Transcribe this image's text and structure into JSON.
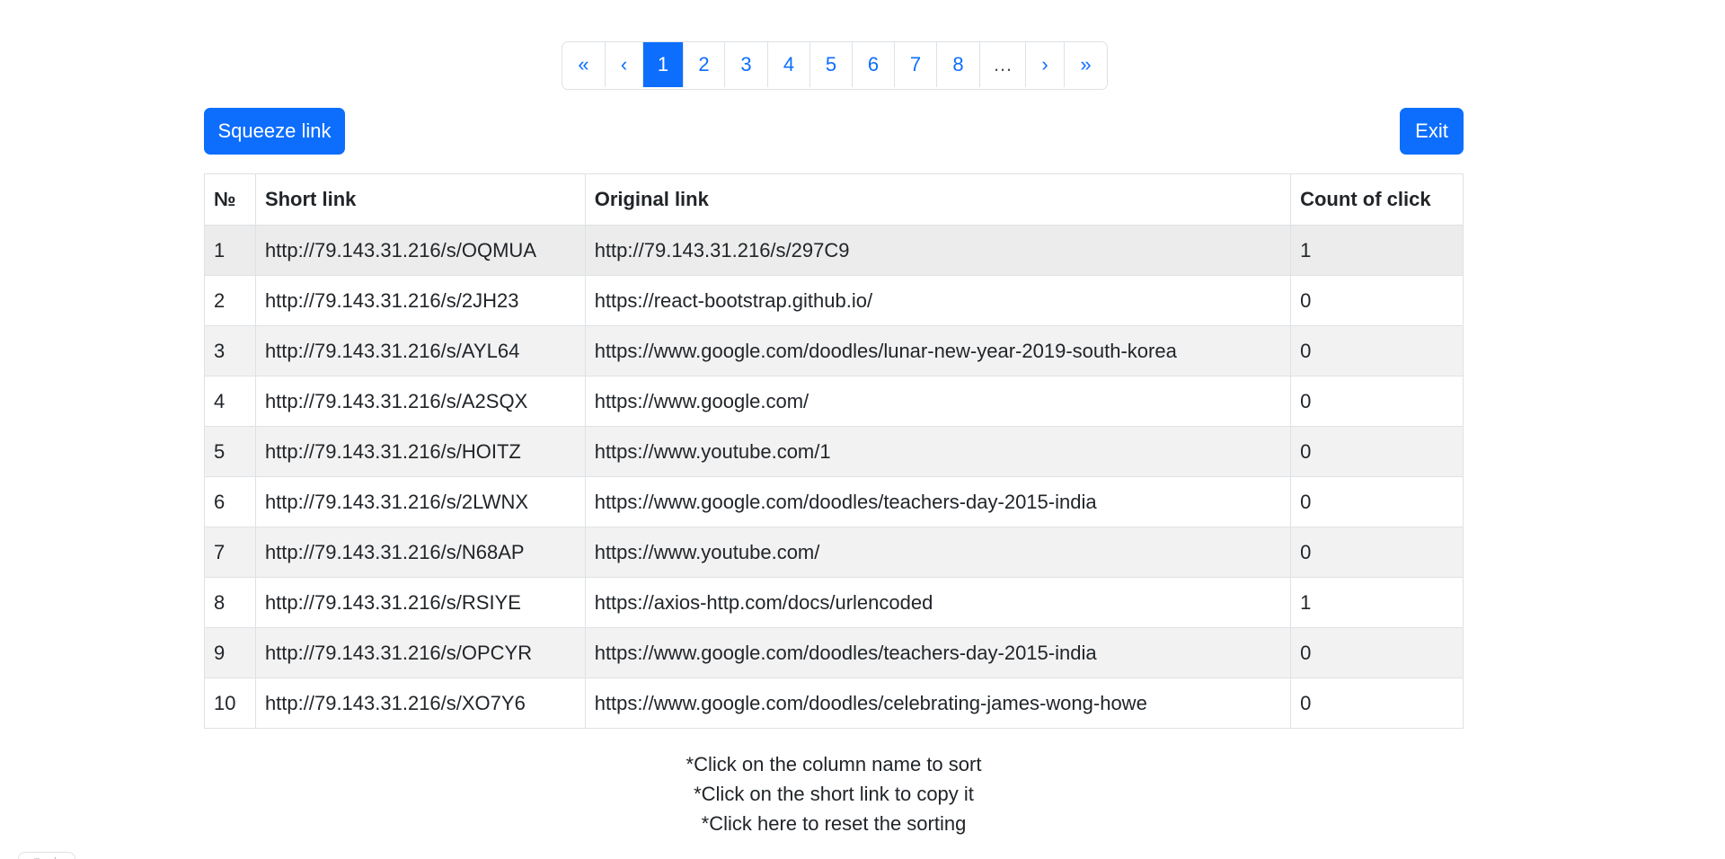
{
  "pagination": {
    "first": "«",
    "prev": "‹",
    "pages": [
      "1",
      "2",
      "3",
      "4",
      "5",
      "6",
      "7",
      "8"
    ],
    "active_page": "1",
    "ellipsis": "…",
    "next": "›",
    "last": "»"
  },
  "actions": {
    "squeeze_label": "Squeeze link",
    "exit_label": "Exit"
  },
  "table": {
    "headers": [
      "№",
      "Short link",
      "Original link",
      "Count of click"
    ],
    "rows": [
      {
        "n": "1",
        "short": "http://79.143.31.216/s/OQMUA",
        "original": "http://79.143.31.216/s/297C9",
        "count": "1"
      },
      {
        "n": "2",
        "short": "http://79.143.31.216/s/2JH23",
        "original": "https://react-bootstrap.github.io/",
        "count": "0"
      },
      {
        "n": "3",
        "short": "http://79.143.31.216/s/AYL64",
        "original": "https://www.google.com/doodles/lunar-new-year-2019-south-korea",
        "count": "0"
      },
      {
        "n": "4",
        "short": "http://79.143.31.216/s/A2SQX",
        "original": "https://www.google.com/",
        "count": "0"
      },
      {
        "n": "5",
        "short": "http://79.143.31.216/s/HOITZ",
        "original": "https://www.youtube.com/1",
        "count": "0"
      },
      {
        "n": "6",
        "short": "http://79.143.31.216/s/2LWNX",
        "original": "https://www.google.com/doodles/teachers-day-2015-india",
        "count": "0"
      },
      {
        "n": "7",
        "short": "http://79.143.31.216/s/N68AP",
        "original": "https://www.youtube.com/",
        "count": "0"
      },
      {
        "n": "8",
        "short": "http://79.143.31.216/s/RSIYE",
        "original": "https://axios-http.com/docs/urlencoded",
        "count": "1"
      },
      {
        "n": "9",
        "short": "http://79.143.31.216/s/OPCYR",
        "original": "https://www.google.com/doodles/teachers-day-2015-india",
        "count": "0"
      },
      {
        "n": "10",
        "short": "http://79.143.31.216/s/XO7Y6",
        "original": "https://www.google.com/doodles/celebrating-james-wong-howe",
        "count": "0"
      }
    ]
  },
  "notes": {
    "sort_hint": "*Click on the column name to sort",
    "copy_hint": "*Click on the short link to copy it",
    "reset_hint": "*Click here to reset the sorting"
  },
  "colors": {
    "accent": "#0d6efd",
    "stripe": "#f2f2f2",
    "border": "#dee2e6"
  }
}
